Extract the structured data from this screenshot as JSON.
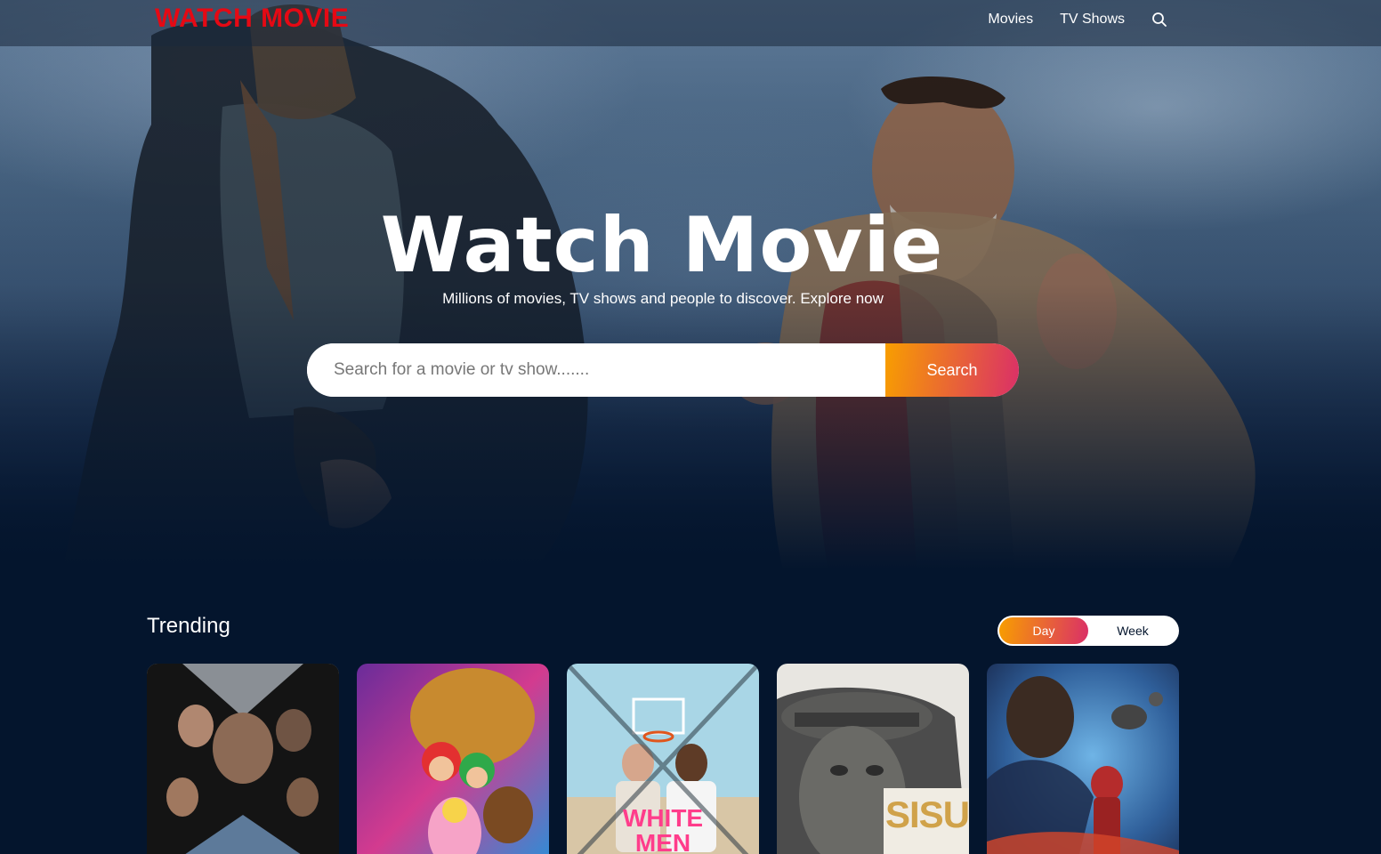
{
  "header": {
    "logo": "WATCH MOVIE",
    "nav": [
      {
        "label": "Movies"
      },
      {
        "label": "TV Shows"
      }
    ]
  },
  "hero": {
    "title": "Watch Movie",
    "subtitle": "Millions of movies, TV shows and people to discover. Explore now",
    "search_placeholder": "Search for a movie or tv show.......",
    "search_button": "Search"
  },
  "trending": {
    "title": "Trending",
    "tabs": [
      {
        "label": "Day",
        "active": true
      },
      {
        "label": "Week",
        "active": false
      }
    ],
    "posters": [
      {
        "name": "poster-fast-x",
        "text": ""
      },
      {
        "name": "poster-super-mario",
        "text": ""
      },
      {
        "name": "poster-white-men",
        "text": "WHITE MEN"
      },
      {
        "name": "poster-sisu",
        "text": "SISU"
      },
      {
        "name": "poster-ant-man",
        "text": ""
      }
    ]
  },
  "colors": {
    "background": "#04152d",
    "logo": "#e50914",
    "gradient_start": "#f89e00",
    "gradient_end": "#da2f68"
  }
}
